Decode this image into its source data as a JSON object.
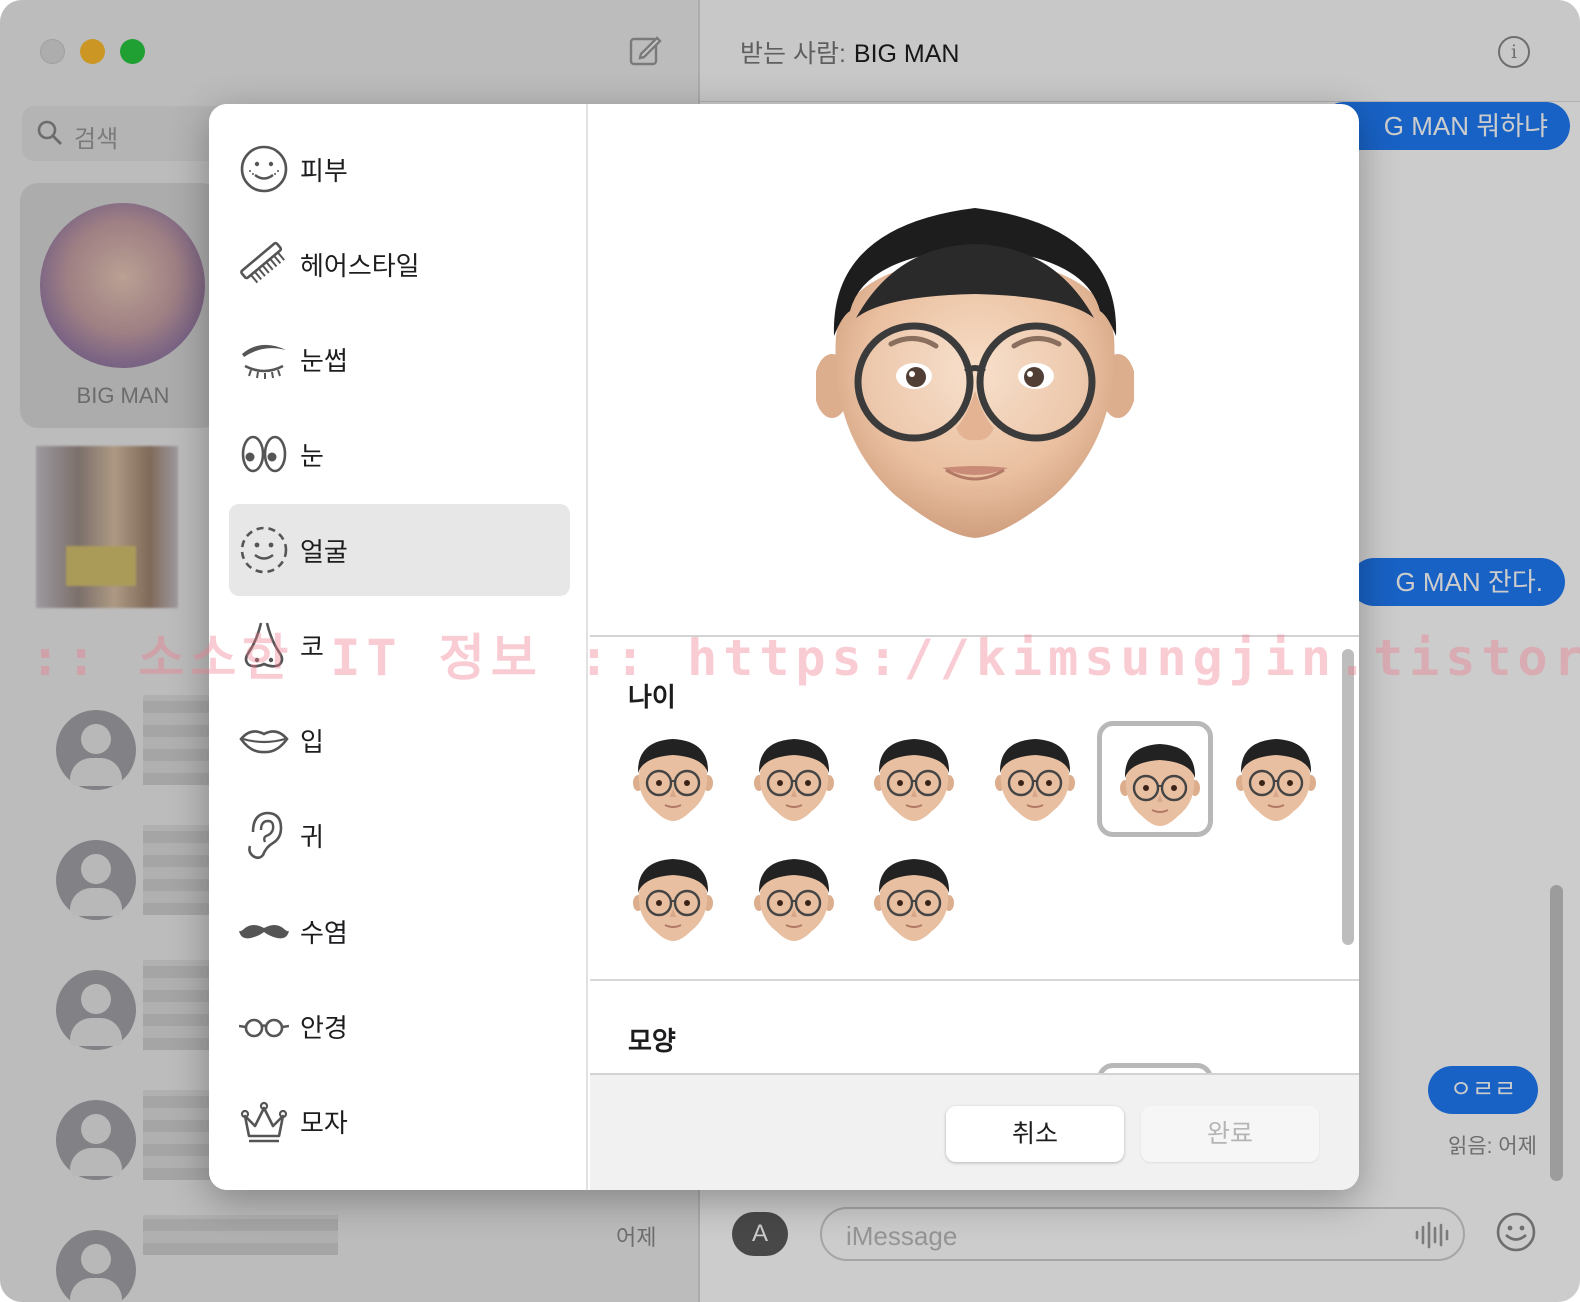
{
  "sidebar": {
    "search_placeholder": "검색",
    "pinned_name": "BIG MAN",
    "list_time": "어제"
  },
  "conversation": {
    "recipient_label": "받는 사람:",
    "recipient_name": "BIG MAN",
    "bubbles": [
      "G MAN 뭐하냐",
      "G MAN 잔다.",
      "ㅇㄹㄹ"
    ],
    "read_status": "읽음: 어제",
    "input_placeholder": "iMessage"
  },
  "memoji_editor": {
    "categories": [
      {
        "label": "피부",
        "icon": "skin-icon"
      },
      {
        "label": "헤어스타일",
        "icon": "comb-icon"
      },
      {
        "label": "눈썹",
        "icon": "eyebrow-icon"
      },
      {
        "label": "눈",
        "icon": "eyes-icon"
      },
      {
        "label": "얼굴",
        "icon": "face-shape-icon"
      },
      {
        "label": "코",
        "icon": "nose-icon"
      },
      {
        "label": "입",
        "icon": "lips-icon"
      },
      {
        "label": "귀",
        "icon": "ear-icon"
      },
      {
        "label": "수염",
        "icon": "mustache-icon"
      },
      {
        "label": "안경",
        "icon": "glasses-icon"
      },
      {
        "label": "모자",
        "icon": "crown-icon"
      }
    ],
    "selected_category": "얼굴",
    "age_section_title": "나이",
    "age_option_count": 9,
    "age_selected_index": 4,
    "shape_section_title": "모양",
    "cancel_label": "취소",
    "done_label": "완료"
  },
  "watermark": ":: 소소한 IT 정보 :: https://kimsungjin.tistory.com ::",
  "colors": {
    "accent": "#1f7bf7",
    "selection": "#e7e7e7"
  }
}
